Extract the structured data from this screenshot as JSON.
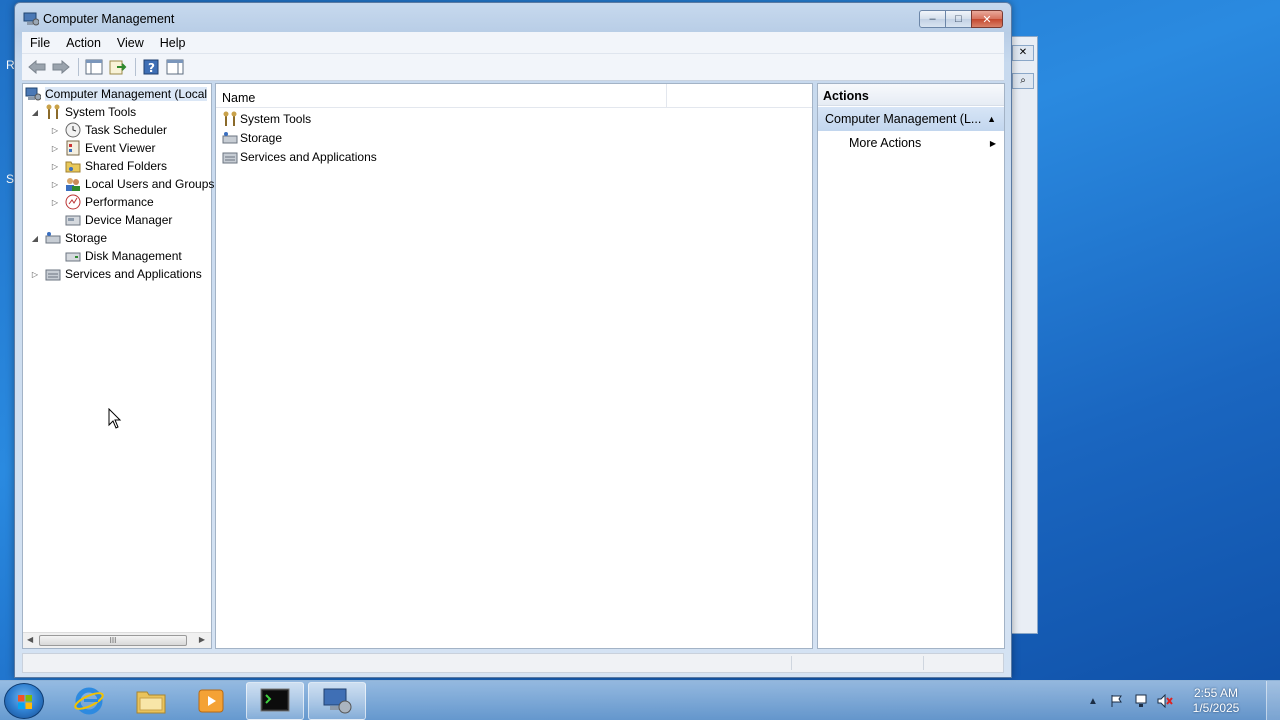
{
  "window": {
    "title": "Computer Management",
    "buttons": {
      "minimize": "–",
      "maximize": "□",
      "close": "✕"
    }
  },
  "menu": [
    "File",
    "Action",
    "View",
    "Help"
  ],
  "toolbar_icons": [
    "back-icon",
    "forward-icon",
    "show-hide-tree-icon",
    "export-list-icon",
    "help-icon",
    "show-hide-action-pane-icon"
  ],
  "tree": {
    "root": "Computer Management (Local",
    "system_tools": "System Tools",
    "task_scheduler": "Task Scheduler",
    "event_viewer": "Event Viewer",
    "shared_folders": "Shared Folders",
    "local_users": "Local Users and Groups",
    "performance": "Performance",
    "device_manager": "Device Manager",
    "storage": "Storage",
    "disk_management": "Disk Management",
    "services": "Services and Applications"
  },
  "list": {
    "column_name": "Name",
    "items": [
      "System Tools",
      "Storage",
      "Services and Applications"
    ]
  },
  "actions": {
    "header": "Actions",
    "section": "Computer Management (L...",
    "more_actions": "More Actions"
  },
  "scroll": {
    "thumb": "III"
  },
  "clock": {
    "time": "2:55 AM",
    "date": "1/5/2025"
  },
  "desktop_letters": [
    "R",
    "S"
  ],
  "colors": {
    "accent": "#2f7fd0",
    "selection": "#dbe7f6",
    "action_section": "#c2d6ee"
  }
}
